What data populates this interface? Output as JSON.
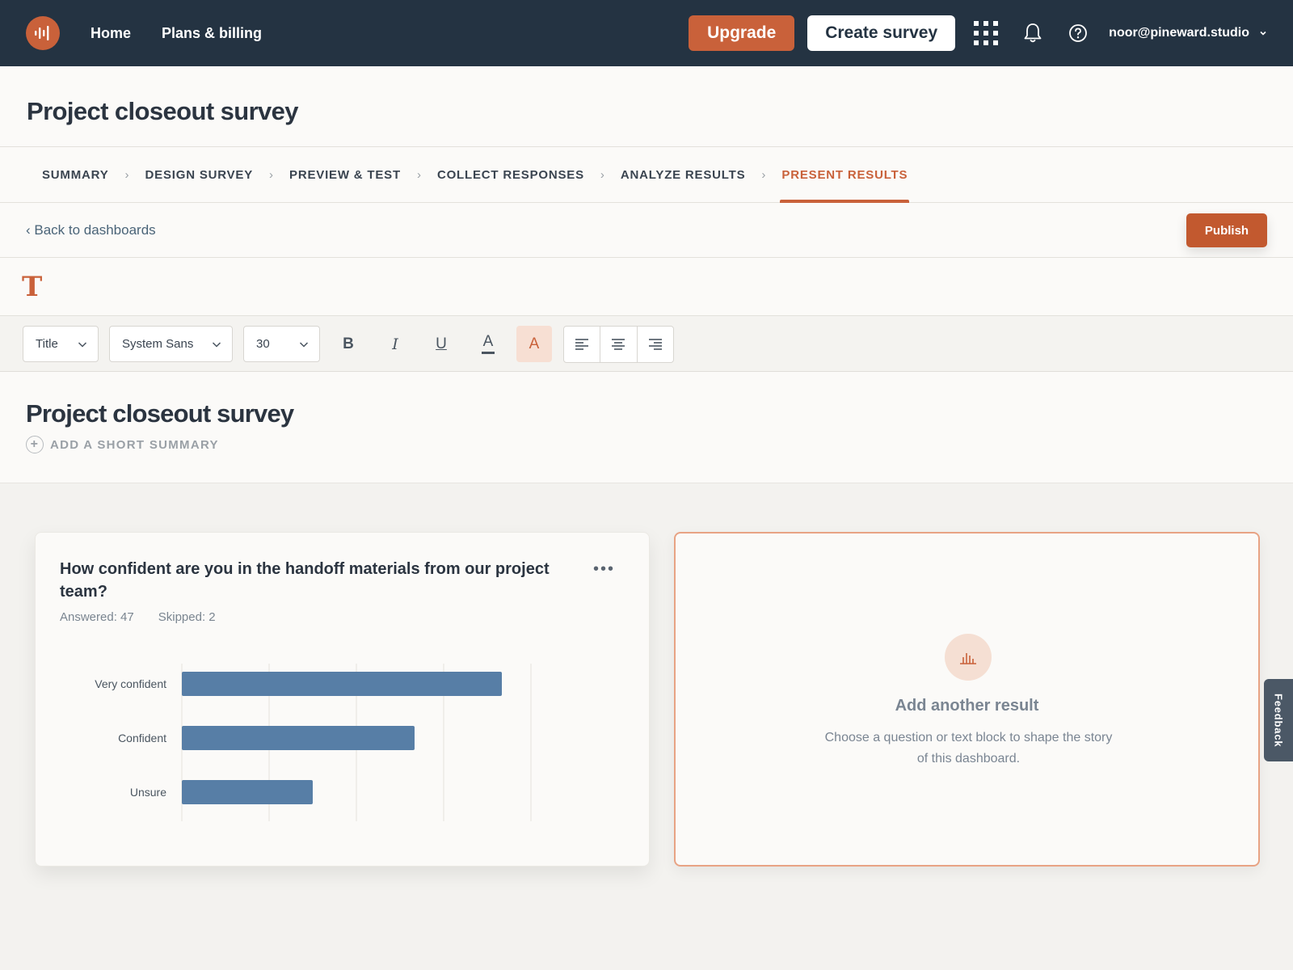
{
  "nav": {
    "home": "Home",
    "billing": "Plans & billing",
    "upgrade": "Upgrade",
    "create": "Create survey",
    "user": "noor@pineward.studio"
  },
  "page": {
    "title": "Project closeout survey"
  },
  "stepper": {
    "steps": [
      "SUMMARY",
      "DESIGN SURVEY",
      "PREVIEW & TEST",
      "COLLECT RESPONSES",
      "ANALYZE RESULTS",
      "PRESENT RESULTS"
    ],
    "active": "PRESENT RESULTS"
  },
  "backbar": {
    "back": "‹ Back to dashboards",
    "publish": "Publish"
  },
  "toolbar": {
    "style": "Title",
    "font": "System Sans",
    "size": "30",
    "bold": "B",
    "italic": "I",
    "underline": "U",
    "text_color": "A",
    "highlight": "A"
  },
  "dashboard": {
    "title": "Project closeout survey",
    "add_summary": "ADD A SHORT SUMMARY"
  },
  "question_card": {
    "title": "How confident are you in the handoff materials from our project team?",
    "answered": "Answered: 47",
    "skipped": "Skipped: 2",
    "more": "•••"
  },
  "chart_data": {
    "type": "bar",
    "orientation": "horizontal",
    "categories": [
      "Very confident",
      "Confident",
      "Unsure"
    ],
    "values": [
      22,
      16,
      9
    ],
    "xlim": [
      0,
      24
    ],
    "grid": true,
    "color": "#577ea6"
  },
  "add_card": {
    "title": "Add another result",
    "desc": "Choose a question or text block to shape the story of this dashboard."
  },
  "feedback": "Feedback",
  "colors": {
    "nav_bg": "#243342",
    "accent": "#c9613a",
    "bar": "#577ea6"
  }
}
